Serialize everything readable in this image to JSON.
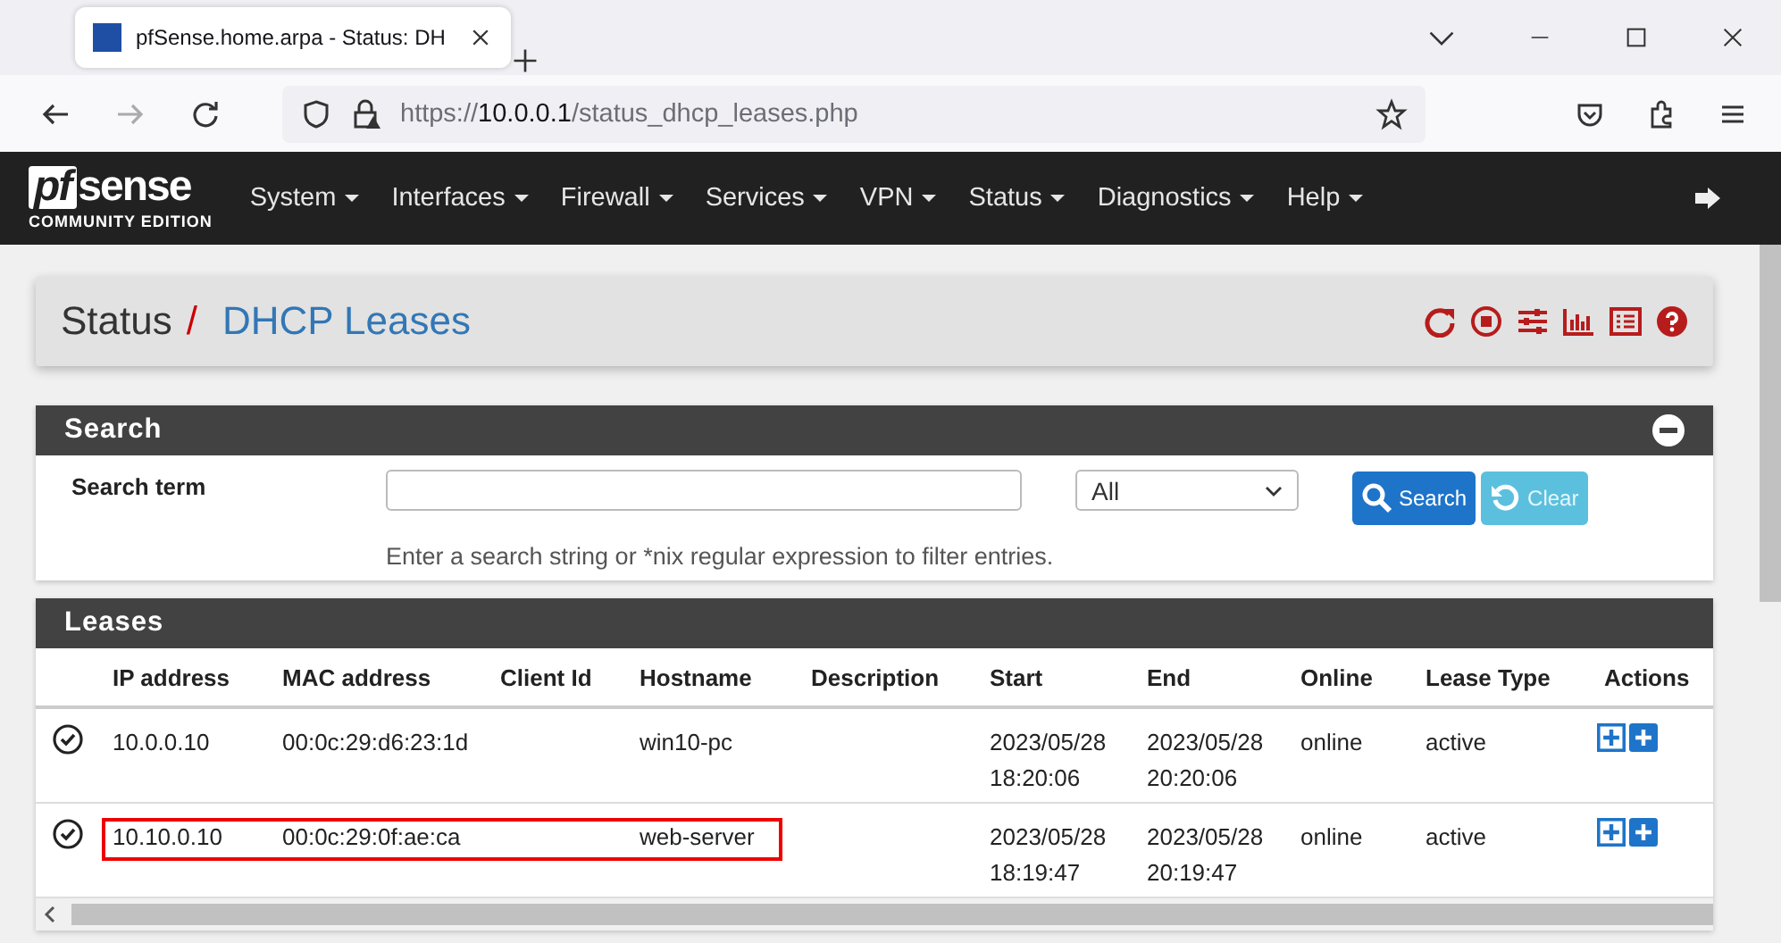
{
  "browser": {
    "tab_title": "pfSense.home.arpa - Status: DH",
    "url_scheme": "https://",
    "url_host": "10.0.0.1",
    "url_path": "/status_dhcp_leases.php"
  },
  "logo": {
    "mark": "pf",
    "name": "sense",
    "edition": "COMMUNITY EDITION"
  },
  "nav": [
    "System",
    "Interfaces",
    "Firewall",
    "Services",
    "VPN",
    "Status",
    "Diagnostics",
    "Help"
  ],
  "breadcrumb": {
    "parent": "Status",
    "separator": "/",
    "current": "DHCP Leases"
  },
  "search": {
    "title": "Search",
    "label": "Search term",
    "filter": "All",
    "search_button": "Search",
    "clear_button": "Clear",
    "help": "Enter a search string or *nix regular expression to filter entries."
  },
  "leases": {
    "title": "Leases",
    "columns": [
      "IP address",
      "MAC address",
      "Client Id",
      "Hostname",
      "Description",
      "Start",
      "End",
      "Online",
      "Lease Type",
      "Actions"
    ],
    "rows": [
      {
        "ip": "10.0.0.10",
        "mac": "00:0c:29:d6:23:1d",
        "client_id": "",
        "hostname": "win10-pc",
        "description": "",
        "start": [
          "2023/05/28",
          "18:20:06"
        ],
        "end": [
          "2023/05/28",
          "20:20:06"
        ],
        "online": "online",
        "lease_type": "active",
        "highlighted": false
      },
      {
        "ip": "10.10.0.10",
        "mac": "00:0c:29:0f:ae:ca",
        "client_id": "",
        "hostname": "web-server",
        "description": "",
        "start": [
          "2023/05/28",
          "18:19:47"
        ],
        "end": [
          "2023/05/28",
          "20:19:47"
        ],
        "online": "online",
        "lease_type": "active",
        "highlighted": true
      }
    ]
  }
}
